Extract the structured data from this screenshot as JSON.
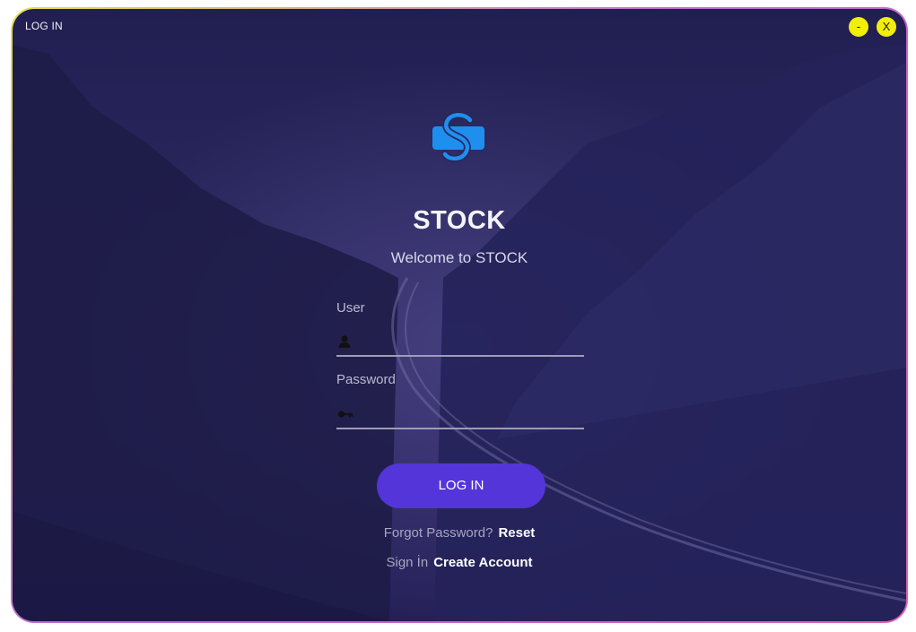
{
  "window": {
    "title": "LOG IN",
    "minimize_label": "-",
    "close_label": "X"
  },
  "brand": {
    "name": "STOCK",
    "welcome": "Welcome to STOCK",
    "logo_icon": "stock-s-logo-icon",
    "logo_color": "#1e8fef"
  },
  "form": {
    "user_label": "User",
    "user_value": "",
    "user_icon": "user-icon",
    "password_label": "Password",
    "password_value": "",
    "password_icon": "key-icon",
    "login_label": "LOG IN",
    "button_color": "#5335da"
  },
  "links": {
    "forgot_text": "Forgot Password?",
    "reset_label": "Reset",
    "signin_text": "Sign İn",
    "create_label": "Create Account"
  }
}
